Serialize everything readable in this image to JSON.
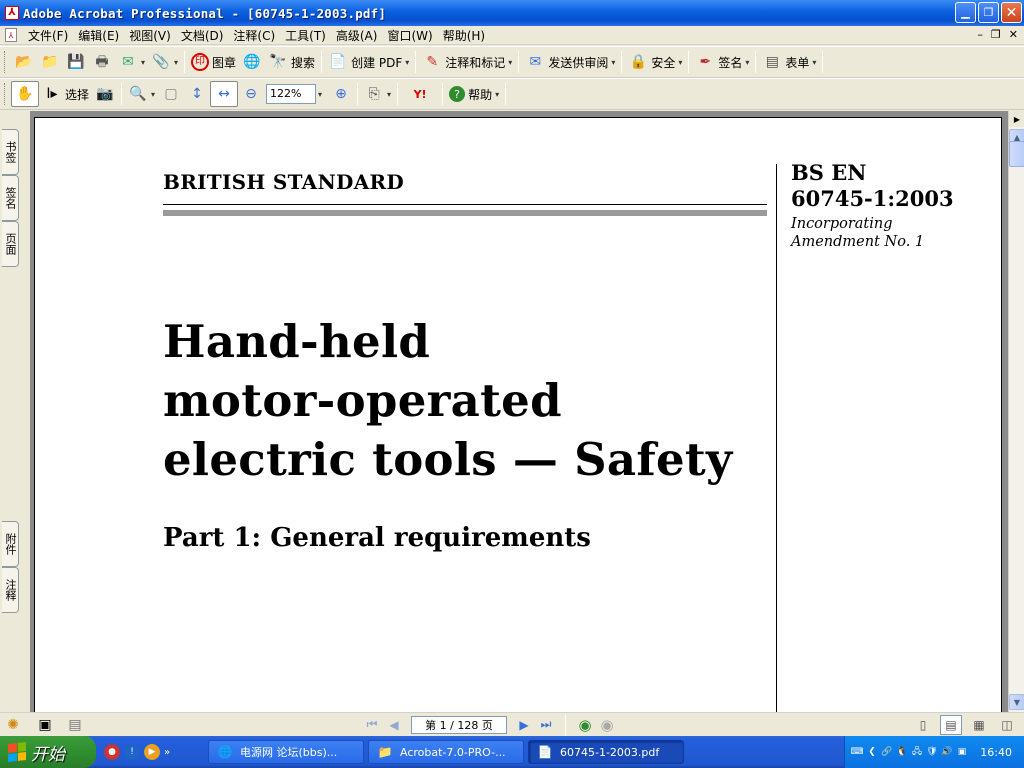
{
  "window": {
    "title": "Adobe Acrobat Professional - [60745-1-2003.pdf]"
  },
  "menubar": {
    "items": [
      "文件(F)",
      "编辑(E)",
      "视图(V)",
      "文档(D)",
      "注释(C)",
      "工具(T)",
      "高级(A)",
      "窗口(W)",
      "帮助(H)"
    ]
  },
  "toolbar1": {
    "stamp_label": "图章",
    "search_label": "搜索",
    "create_pdf_label": "创建 PDF",
    "comment_label": "注释和标记",
    "send_review_label": "发送供审阅",
    "security_label": "安全",
    "sign_label": "签名",
    "forms_label": "表单"
  },
  "toolbar2": {
    "select_label": "选择",
    "zoom_value": "122%",
    "help_label": "帮助"
  },
  "sidebar": {
    "tabs_top": [
      "书签",
      "签名",
      "页面"
    ],
    "tabs_bottom": [
      "附件",
      "注释"
    ]
  },
  "document": {
    "standard_label": "BRITISH STANDARD",
    "standard_code_line1": "BS EN",
    "standard_code_line2": "60745-1:2003",
    "amend_line1": "Incorporating",
    "amend_line2": "Amendment No. 1",
    "title_lines": [
      "Hand-held",
      "motor-operated",
      "electric tools — Safety"
    ],
    "subtitle": "Part 1: General requirements"
  },
  "statusbar": {
    "page_indicator": "第 1 / 128 页"
  },
  "taskbar": {
    "start_label": "开始",
    "tasks": [
      "电源网 论坛(bbs)...",
      "Acrobat-7.0-PRO-...",
      "60745-1-2003.pdf"
    ],
    "clock": "16:40"
  },
  "colors": {
    "titlebar": "#0a5fe0",
    "taskbar": "#245edb",
    "start": "#2f8f2f",
    "tray": "#0c70e0"
  }
}
